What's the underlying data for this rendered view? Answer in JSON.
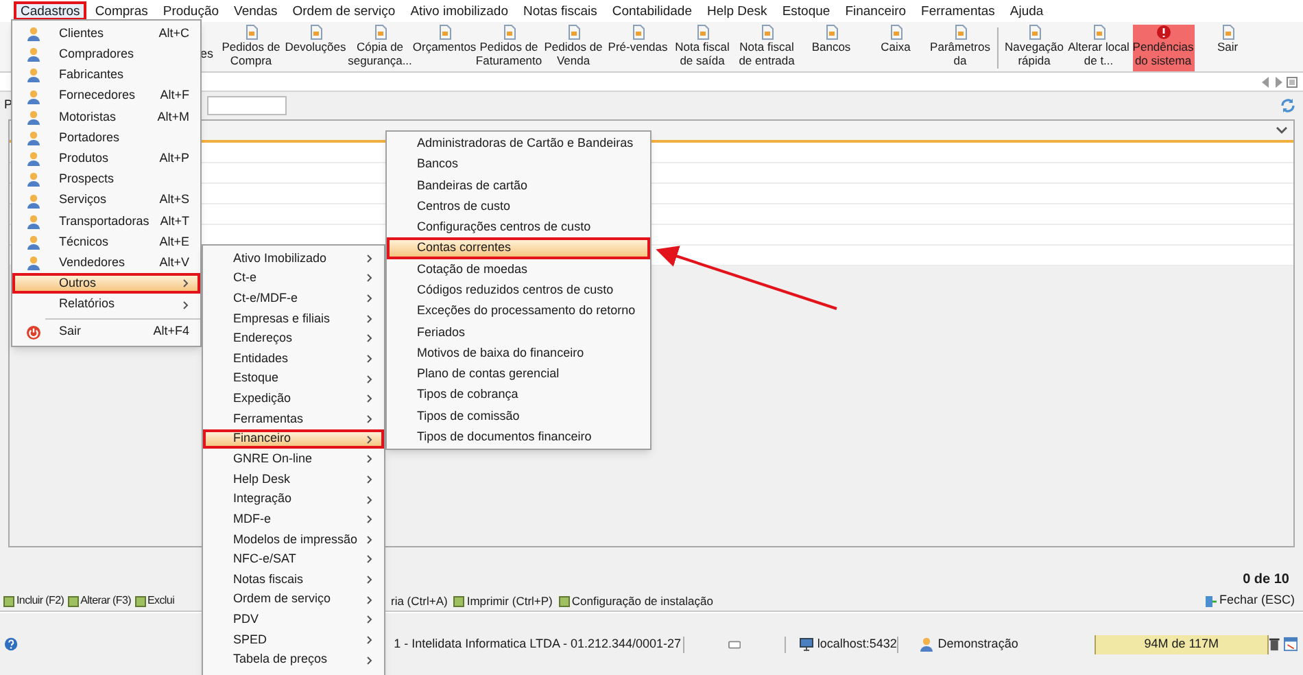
{
  "menubar": [
    {
      "label": "Cadastros",
      "selected": true
    },
    {
      "label": "Compras",
      "selected": false
    },
    {
      "label": "Produção",
      "selected": false
    },
    {
      "label": "Vendas",
      "selected": false
    },
    {
      "label": "Ordem de serviço",
      "selected": false
    },
    {
      "label": "Ativo imobilizado",
      "selected": false
    },
    {
      "label": "Notas fiscais",
      "selected": false
    },
    {
      "label": "Contabilidade",
      "selected": false
    },
    {
      "label": "Help Desk",
      "selected": false
    },
    {
      "label": "Estoque",
      "selected": false
    },
    {
      "label": "Financeiro",
      "selected": false
    },
    {
      "label": "Ferramentas",
      "selected": false
    },
    {
      "label": "Ajuda",
      "selected": false
    }
  ],
  "toolbar": [
    {
      "kind": "fragment",
      "lines": [
        "es"
      ]
    },
    {
      "kind": "button",
      "lines": [
        "Pedidos de",
        "Compra"
      ],
      "highlighted": false
    },
    {
      "kind": "button",
      "lines": [
        "Devoluções"
      ],
      "highlighted": false
    },
    {
      "kind": "button",
      "lines": [
        "Cópia de",
        "segurança..."
      ],
      "highlighted": false
    },
    {
      "kind": "button",
      "lines": [
        "Orçamentos"
      ],
      "highlighted": false
    },
    {
      "kind": "button",
      "lines": [
        "Pedidos de",
        "Faturamento"
      ],
      "highlighted": false
    },
    {
      "kind": "button",
      "lines": [
        "Pedidos de",
        "Venda"
      ],
      "highlighted": false
    },
    {
      "kind": "button",
      "lines": [
        "Pré-vendas"
      ],
      "highlighted": false
    },
    {
      "kind": "button",
      "lines": [
        "Nota fiscal",
        "de saída"
      ],
      "highlighted": false
    },
    {
      "kind": "button",
      "lines": [
        "Nota fiscal",
        "de entrada"
      ],
      "highlighted": false
    },
    {
      "kind": "button",
      "lines": [
        "Bancos"
      ],
      "highlighted": false
    },
    {
      "kind": "button",
      "lines": [
        "Caixa"
      ],
      "highlighted": false
    },
    {
      "kind": "button",
      "lines": [
        "Parâmetros",
        "da"
      ],
      "highlighted": false
    },
    {
      "kind": "separator"
    },
    {
      "kind": "button",
      "lines": [
        "Navegação",
        "rápida"
      ],
      "highlighted": false
    },
    {
      "kind": "button",
      "lines": [
        "Alterar local",
        "de t..."
      ],
      "highlighted": false
    },
    {
      "kind": "button",
      "lines": [
        "Pendências",
        "do sistema"
      ],
      "highlighted": true
    },
    {
      "kind": "button",
      "lines": [
        "Sair"
      ],
      "highlighted": false
    }
  ],
  "filter": {
    "label": "P"
  },
  "record_count": "0 de 10",
  "actions": [
    {
      "label": "Incluir (F2)"
    },
    {
      "label": "Alterar (F3)"
    },
    {
      "label": "Exclui"
    },
    {
      "label": "ria (Ctrl+A)"
    },
    {
      "label": "Imprimir (Ctrl+P)"
    },
    {
      "label": "Configuração de instalação"
    }
  ],
  "close_action": {
    "label": "Fechar (ESC)"
  },
  "status_bar": {
    "company": "1 - Intelidata Informatica LTDA - 01.212.344/0001-27",
    "server": "localhost:5432",
    "user": "Demonstração",
    "memory": "94M de 117M"
  },
  "cadastros_menu": [
    {
      "kind": "item",
      "label": "Clientes",
      "shortcut": "Alt+C",
      "has_icon": true,
      "submenu": false,
      "selected": false
    },
    {
      "kind": "item",
      "label": "Compradores",
      "has_icon": true,
      "submenu": false,
      "selected": false
    },
    {
      "kind": "item",
      "label": "Fabricantes",
      "has_icon": true,
      "submenu": false,
      "selected": false
    },
    {
      "kind": "item",
      "label": "Fornecedores",
      "shortcut": "Alt+F",
      "has_icon": true,
      "submenu": false,
      "selected": false
    },
    {
      "kind": "item",
      "label": "Motoristas",
      "shortcut": "Alt+M",
      "has_icon": true,
      "submenu": false,
      "selected": false
    },
    {
      "kind": "item",
      "label": "Portadores",
      "has_icon": true,
      "submenu": false,
      "selected": false
    },
    {
      "kind": "item",
      "label": "Produtos",
      "shortcut": "Alt+P",
      "has_icon": true,
      "submenu": false,
      "selected": false
    },
    {
      "kind": "item",
      "label": "Prospects",
      "has_icon": true,
      "submenu": false,
      "selected": false
    },
    {
      "kind": "item",
      "label": "Serviços",
      "shortcut": "Alt+S",
      "has_icon": true,
      "submenu": false,
      "selected": false
    },
    {
      "kind": "item",
      "label": "Transportadoras",
      "shortcut": "Alt+T",
      "has_icon": true,
      "submenu": false,
      "selected": false
    },
    {
      "kind": "item",
      "label": "Técnicos",
      "shortcut": "Alt+E",
      "has_icon": true,
      "submenu": false,
      "selected": false
    },
    {
      "kind": "item",
      "label": "Vendedores",
      "shortcut": "Alt+V",
      "has_icon": true,
      "submenu": false,
      "selected": false
    },
    {
      "kind": "item",
      "label": "Outros",
      "has_icon": false,
      "submenu": true,
      "selected": true
    },
    {
      "kind": "item",
      "label": "Relatórios",
      "has_icon": false,
      "submenu": true,
      "selected": false
    },
    {
      "kind": "separator"
    },
    {
      "kind": "exit",
      "label": "Sair",
      "shortcut": "Alt+F4",
      "has_icon": true,
      "submenu": false,
      "selected": false
    }
  ],
  "outros_menu": [
    {
      "label": "Ativo Imobilizado",
      "selected": false
    },
    {
      "label": "Ct-e",
      "selected": false
    },
    {
      "label": "Ct-e/MDF-e",
      "selected": false
    },
    {
      "label": "Empresas e filiais",
      "selected": false
    },
    {
      "label": "Endereços",
      "selected": false
    },
    {
      "label": "Entidades",
      "selected": false
    },
    {
      "label": "Estoque",
      "selected": false
    },
    {
      "label": "Expedição",
      "selected": false
    },
    {
      "label": "Ferramentas",
      "selected": false
    },
    {
      "label": "Financeiro",
      "selected": true
    },
    {
      "label": "GNRE On-line",
      "selected": false
    },
    {
      "label": "Help Desk",
      "selected": false
    },
    {
      "label": "Integração",
      "selected": false
    },
    {
      "label": "MDF-e",
      "selected": false
    },
    {
      "label": "Modelos de impressão",
      "selected": false
    },
    {
      "label": "NFC-e/SAT",
      "selected": false
    },
    {
      "label": "Notas fiscais",
      "selected": false
    },
    {
      "label": "Ordem de serviço",
      "selected": false
    },
    {
      "label": "PDV",
      "selected": false
    },
    {
      "label": "SPED",
      "selected": false
    },
    {
      "label": "Tabela de preços",
      "selected": false
    }
  ],
  "financeiro_menu": [
    {
      "label": "Administradoras de Cartão e Bandeiras",
      "selected": false
    },
    {
      "label": "Bancos",
      "selected": false
    },
    {
      "label": "Bandeiras de cartão",
      "selected": false
    },
    {
      "label": "Centros de custo",
      "selected": false
    },
    {
      "label": "Configurações centros de custo",
      "selected": false
    },
    {
      "label": "Contas correntes",
      "selected": true
    },
    {
      "label": "Cotação de moedas",
      "selected": false
    },
    {
      "label": "Códigos reduzidos centros de custo",
      "selected": false
    },
    {
      "label": "Exceções do processamento do retorno",
      "selected": false
    },
    {
      "label": "Feriados",
      "selected": false
    },
    {
      "label": "Motivos de baixa do financeiro",
      "selected": false
    },
    {
      "label": "Plano de contas gerencial",
      "selected": false
    },
    {
      "label": "Tipos de cobrança",
      "selected": false
    },
    {
      "label": "Tipos de comissão",
      "selected": false
    },
    {
      "label": "Tipos de documentos financeiro",
      "selected": false
    }
  ]
}
